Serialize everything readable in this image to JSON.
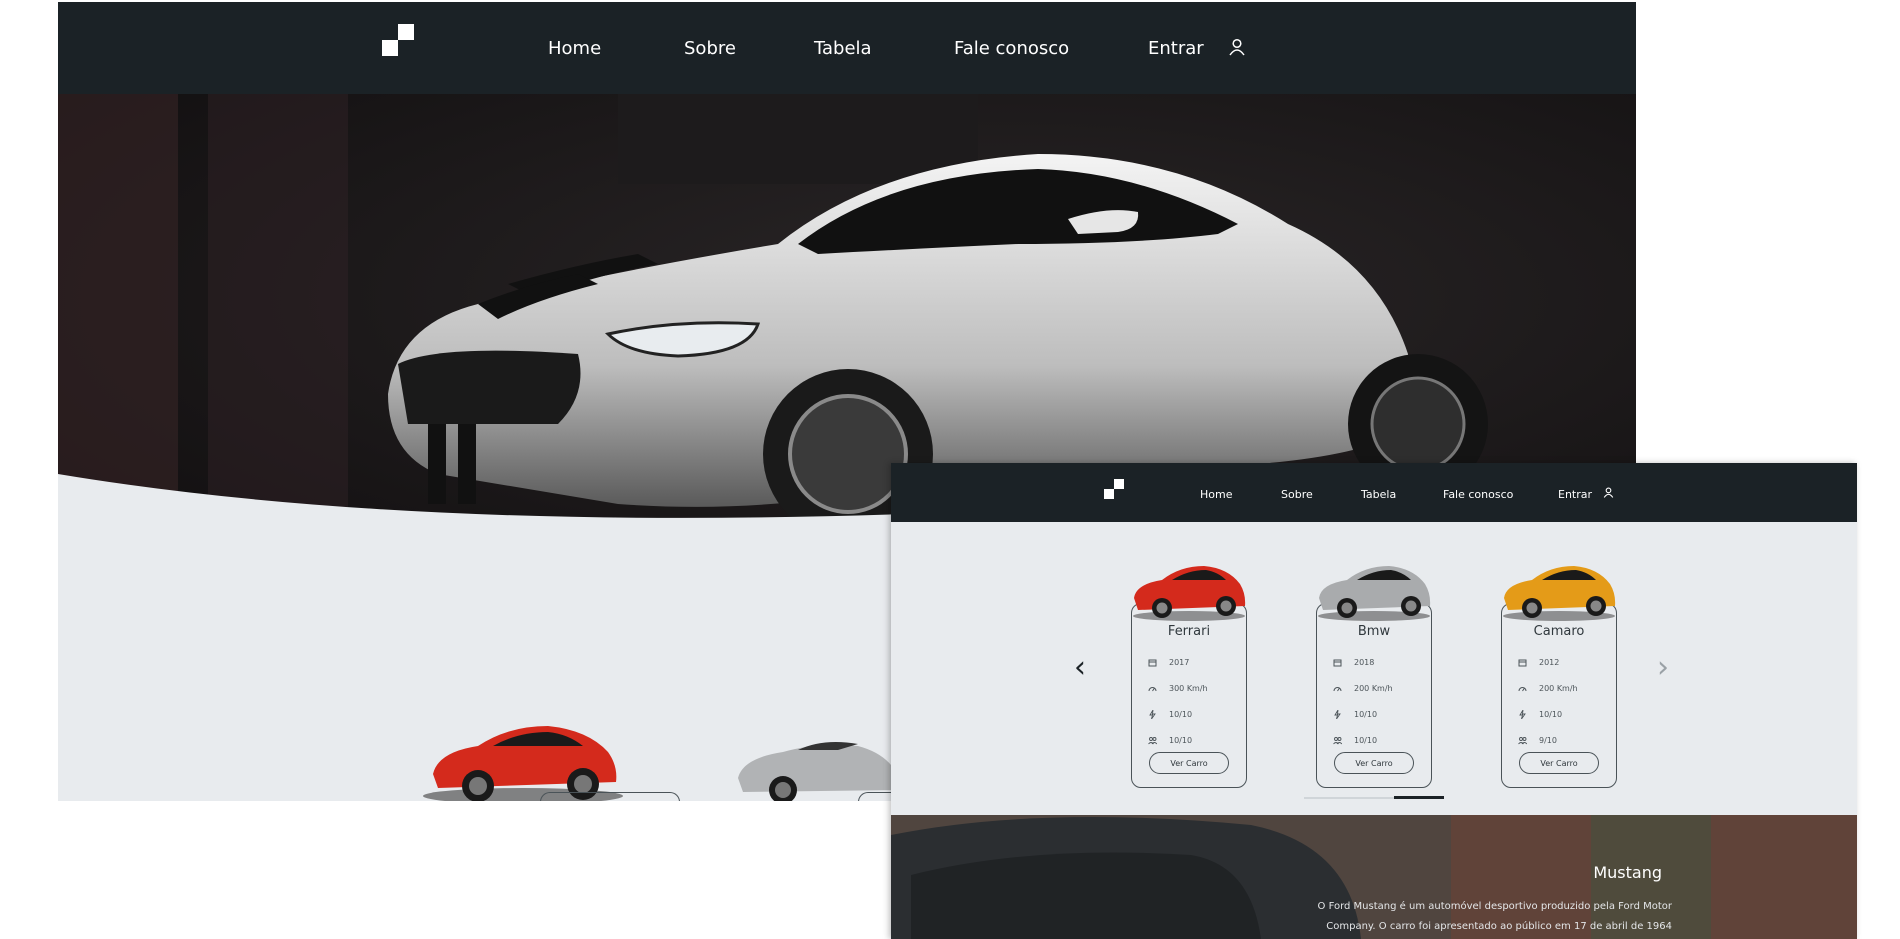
{
  "main_window": {
    "nav": {
      "links": [
        "Home",
        "Sobre",
        "Tabela",
        "Fale conosco",
        "Entrar"
      ],
      "icons": {
        "logo": "checker-logo",
        "user": "user-icon"
      }
    },
    "hero": {
      "subject": "white Ford Mustang with black racing stripes"
    }
  },
  "front_window": {
    "nav": {
      "links": [
        "Home",
        "Sobre",
        "Tabela",
        "Fale conosco",
        "Entrar"
      ],
      "icons": {
        "logo": "checker-logo",
        "user": "user-icon"
      }
    },
    "carousel": {
      "prev_icon": "‹",
      "next_icon": "›",
      "progress": 0.35,
      "cards": [
        {
          "name": "Ferrari",
          "color": "#d42a1c",
          "year": "2017",
          "speed": "300 Km/h",
          "power": "10/10",
          "seats": "10/10",
          "button": "Ver Carro"
        },
        {
          "name": "Bmw",
          "color": "#a9abad",
          "year": "2018",
          "speed": "200 Km/h",
          "power": "10/10",
          "seats": "10/10",
          "button": "Ver Carro"
        },
        {
          "name": "Camaro",
          "color": "#e49b18",
          "year": "2012",
          "speed": "200 Km/h",
          "power": "10/10",
          "seats": "9/10",
          "button": "Ver Carro"
        }
      ]
    },
    "about": {
      "title": "Mustang",
      "text_line_1": "O Ford Mustang é um automóvel desportivo produzido pela Ford Motor",
      "text_line_2": "Company. O carro foi apresentado ao público em 17 de abril de 1964"
    }
  },
  "colors": {
    "navbar": "#1b2226",
    "page_bg": "#e8ebee",
    "text_dark": "#30383d"
  }
}
